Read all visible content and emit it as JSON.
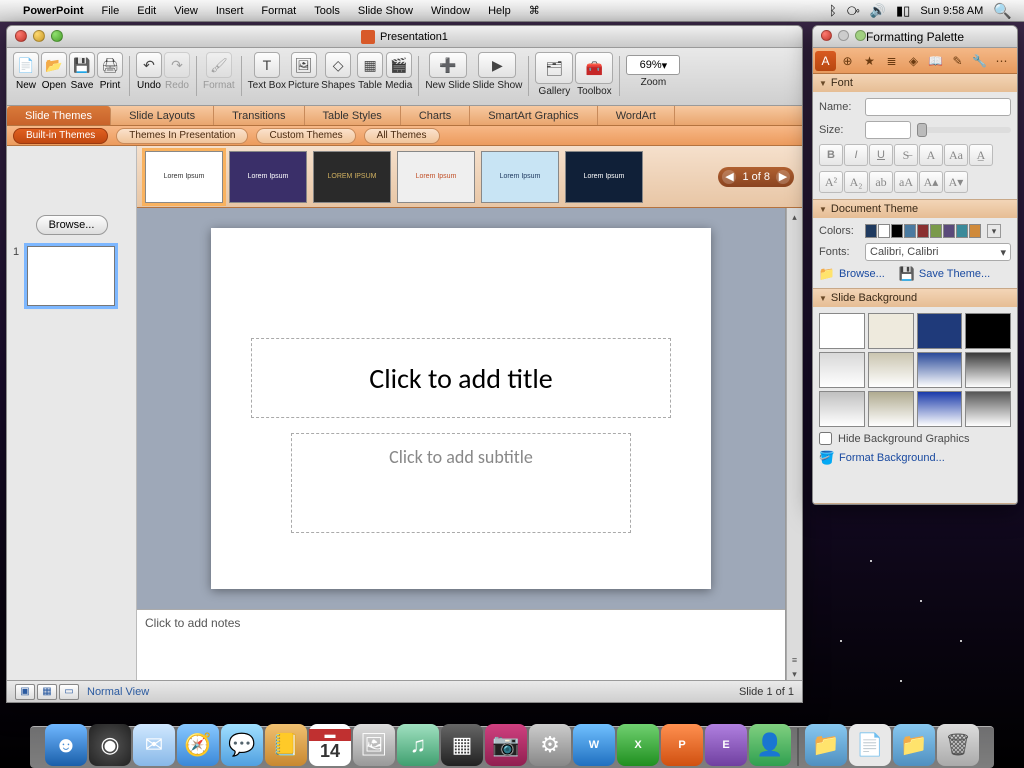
{
  "menubar": {
    "app": "PowerPoint",
    "items": [
      "File",
      "Edit",
      "View",
      "Insert",
      "Format",
      "Tools",
      "Slide Show",
      "Window",
      "Help"
    ],
    "clock": "Sun 9:58 AM"
  },
  "window": {
    "title": "Presentation1",
    "toolbar": {
      "new": "New",
      "open": "Open",
      "save": "Save",
      "print": "Print",
      "undo": "Undo",
      "redo": "Redo",
      "format": "Format",
      "textbox": "Text Box",
      "picture": "Picture",
      "shapes": "Shapes",
      "table": "Table",
      "media": "Media",
      "newslide": "New Slide",
      "slideshow": "Slide Show",
      "gallery": "Gallery",
      "toolbox": "Toolbox",
      "zoom": "Zoom",
      "zoomval": "69%"
    },
    "ribtabs": [
      "Slide Themes",
      "Slide Layouts",
      "Transitions",
      "Table Styles",
      "Charts",
      "SmartArt Graphics",
      "WordArt"
    ],
    "subtabs": {
      "builtin": "Built-in Themes",
      "inpres": "Themes In Presentation",
      "custom": "Custom Themes",
      "all": "All Themes"
    },
    "gallery": {
      "browse": "Browse...",
      "pager": "1 of 8",
      "thumbs": [
        {
          "label": "Lorem Ipsum",
          "bg": "#ffffff",
          "fg": "#333333"
        },
        {
          "label": "Lorem Ipsum",
          "bg": "#3a2f69",
          "fg": "#ffffff"
        },
        {
          "label": "LOREM IPSUM",
          "bg": "#2a2a2a",
          "fg": "#d0b060"
        },
        {
          "label": "Lorem Ipsum",
          "bg": "#efefef",
          "fg": "#c05028"
        },
        {
          "label": "Lorem Ipsum",
          "bg": "#c8e4f4",
          "fg": "#203a60"
        },
        {
          "label": "Lorem Ipsum",
          "bg": "#102038",
          "fg": "#ffffff"
        }
      ]
    },
    "slide": {
      "title_ph": "Click to add title",
      "subtitle_ph": "Click to add subtitle",
      "notes_ph": "Click to add notes",
      "num": "1"
    },
    "status": {
      "view": "Normal View",
      "pos": "Slide 1 of 1"
    }
  },
  "palette": {
    "title": "Formatting Palette",
    "sections": {
      "font": "Font",
      "name": "Name:",
      "size": "Size:",
      "theme": "Document Theme",
      "colors": "Colors:",
      "fonts": "Fonts:",
      "fontsel": "Calibri, Calibri",
      "browse": "Browse...",
      "savetheme": "Save Theme...",
      "bg": "Slide Background",
      "hidebg": "Hide Background Graphics",
      "formatbg": "Format Background..."
    },
    "swatches": [
      "#1f3a5f",
      "#ffffff",
      "#000000",
      "#4a7aa0",
      "#8a3030",
      "#7a9a4a",
      "#5a4a7a",
      "#3a8a9a",
      "#d08a3a"
    ],
    "bgswatches": [
      "#ffffff",
      "#eeeadd",
      "#1f3a7a",
      "#000000",
      "#d8d8d8",
      "#cac5b0",
      "#2a4a9a",
      "#3a3a3a",
      "#c0c0c0",
      "#b0ab90",
      "#1a3aaa",
      "#555555"
    ]
  }
}
